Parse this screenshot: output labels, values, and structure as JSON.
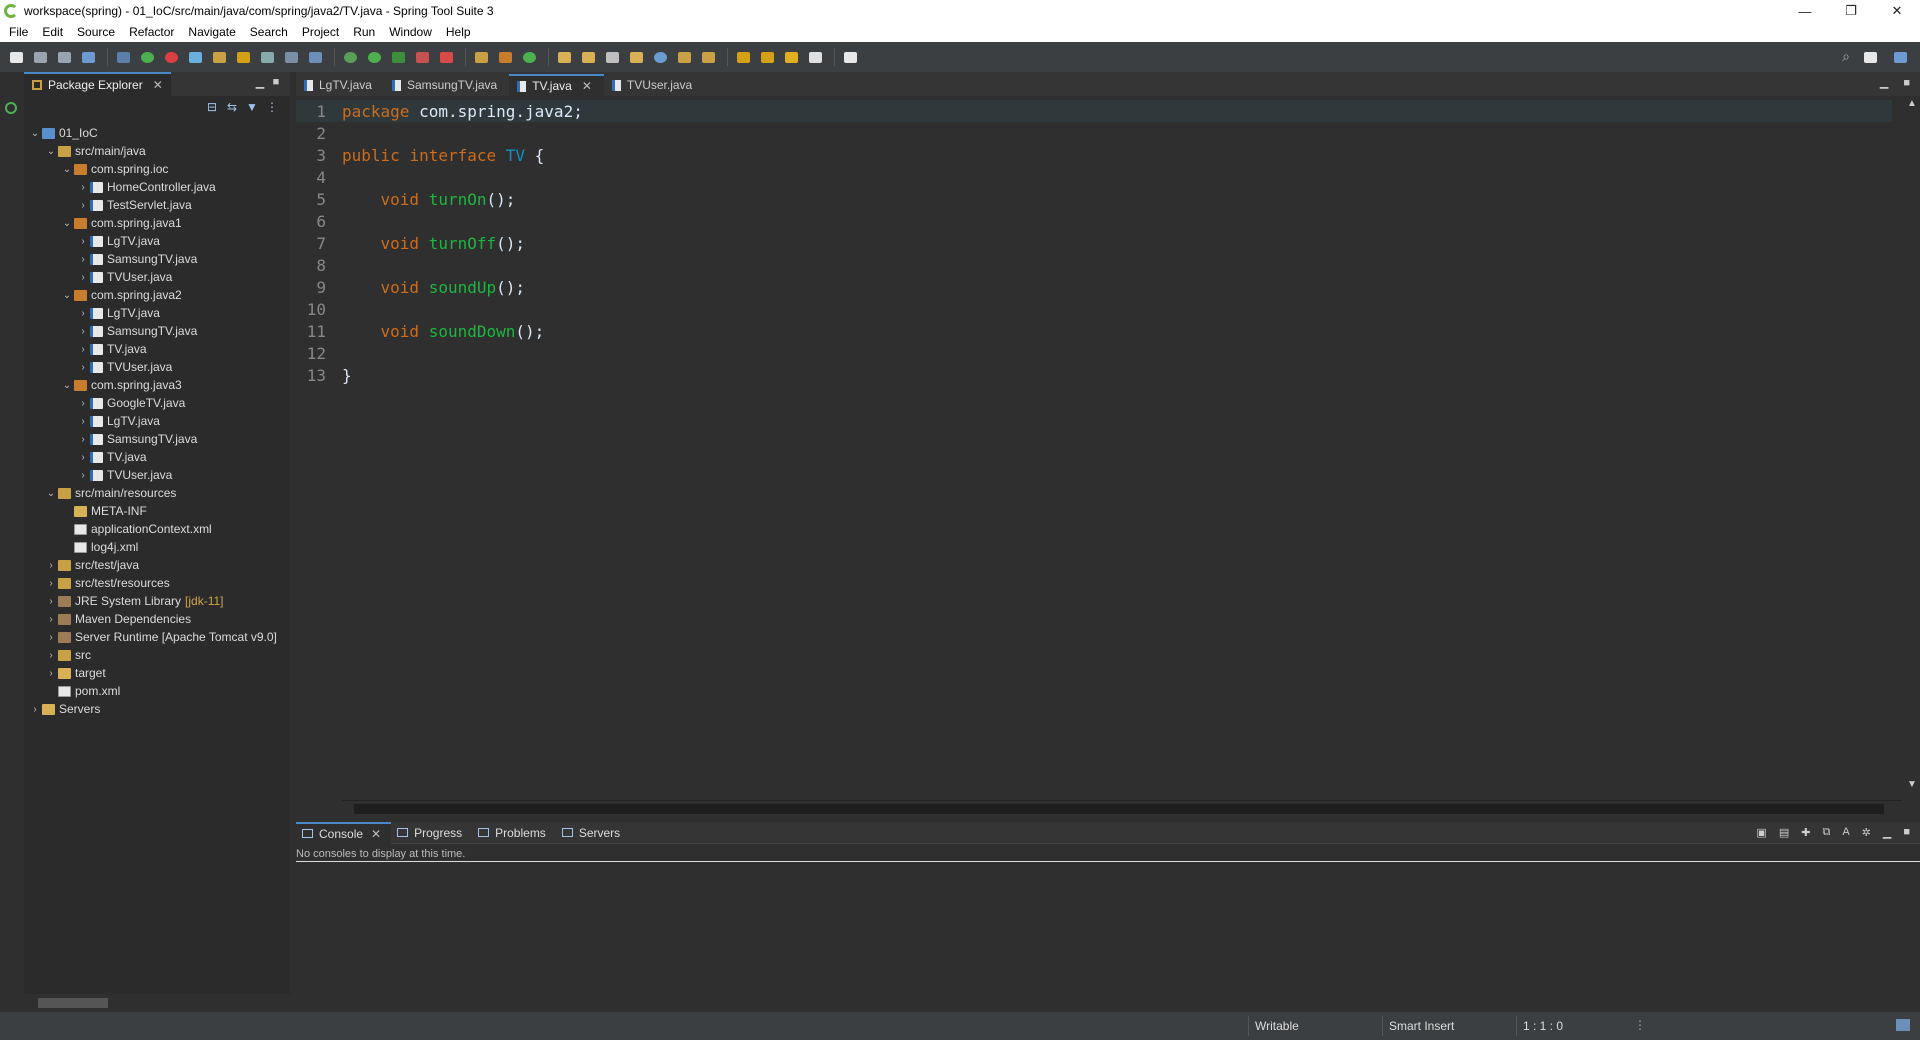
{
  "window": {
    "title": "workspace(spring) - 01_IoC/src/main/java/com/spring/java2/TV.java - Spring Tool Suite 3",
    "min_glyph": "—",
    "restore_glyph": "❐",
    "close_glyph": "✕"
  },
  "menu": [
    "File",
    "Edit",
    "Source",
    "Refactor",
    "Navigate",
    "Search",
    "Project",
    "Run",
    "Window",
    "Help"
  ],
  "explorer": {
    "tab_label": "Package Explorer",
    "close_glyph": "✕",
    "rows": [
      {
        "label": "01_IoC",
        "icon": "project-icon",
        "expanded": true,
        "level": 0
      },
      {
        "label": "src/main/java",
        "icon": "source-folder-icon",
        "expanded": true,
        "level": 1
      },
      {
        "label": "com.spring.ioc",
        "icon": "package-icon",
        "expanded": true,
        "level": 2
      },
      {
        "label": "HomeController.java",
        "icon": "java-file-icon",
        "expanded": false,
        "level": 3
      },
      {
        "label": "TestServlet.java",
        "icon": "java-file-icon",
        "expanded": false,
        "level": 3
      },
      {
        "label": "com.spring.java1",
        "icon": "package-icon",
        "expanded": true,
        "level": 2
      },
      {
        "label": "LgTV.java",
        "icon": "java-file-icon",
        "expanded": false,
        "level": 3
      },
      {
        "label": "SamsungTV.java",
        "icon": "java-file-icon",
        "expanded": false,
        "level": 3
      },
      {
        "label": "TVUser.java",
        "icon": "java-file-icon",
        "expanded": false,
        "level": 3
      },
      {
        "label": "com.spring.java2",
        "icon": "package-icon",
        "expanded": true,
        "level": 2
      },
      {
        "label": "LgTV.java",
        "icon": "java-file-icon",
        "expanded": false,
        "level": 3
      },
      {
        "label": "SamsungTV.java",
        "icon": "java-file-icon",
        "expanded": false,
        "level": 3
      },
      {
        "label": "TV.java",
        "icon": "java-file-icon",
        "expanded": false,
        "level": 3
      },
      {
        "label": "TVUser.java",
        "icon": "java-file-icon",
        "expanded": false,
        "level": 3
      },
      {
        "label": "com.spring.java3",
        "icon": "package-icon",
        "expanded": true,
        "level": 2
      },
      {
        "label": "GoogleTV.java",
        "icon": "java-file-icon",
        "expanded": false,
        "level": 3
      },
      {
        "label": "LgTV.java",
        "icon": "java-file-icon",
        "expanded": false,
        "level": 3
      },
      {
        "label": "SamsungTV.java",
        "icon": "java-file-icon",
        "expanded": false,
        "level": 3
      },
      {
        "label": "TV.java",
        "icon": "java-file-icon",
        "expanded": false,
        "level": 3
      },
      {
        "label": "TVUser.java",
        "icon": "java-file-icon",
        "expanded": false,
        "level": 3
      },
      {
        "label": "src/main/resources",
        "icon": "source-folder-icon",
        "expanded": true,
        "level": 1
      },
      {
        "label": "META-INF",
        "icon": "folder-icon",
        "expanded": null,
        "level": 2
      },
      {
        "label": "applicationContext.xml",
        "icon": "xml-file-icon",
        "expanded": null,
        "level": 2
      },
      {
        "label": "log4j.xml",
        "icon": "xml-file-icon",
        "expanded": null,
        "level": 2
      },
      {
        "label": "src/test/java",
        "icon": "source-folder-icon",
        "expanded": false,
        "level": 1
      },
      {
        "label": "src/test/resources",
        "icon": "source-folder-icon",
        "expanded": false,
        "level": 1
      },
      {
        "label": "JRE System Library",
        "annotation": "[jdk-11]",
        "icon": "library-icon",
        "expanded": false,
        "level": 1
      },
      {
        "label": "Maven Dependencies",
        "icon": "library-icon",
        "expanded": false,
        "level": 1
      },
      {
        "label": "Server Runtime [Apache Tomcat v9.0]",
        "icon": "library-icon",
        "expanded": false,
        "level": 1
      },
      {
        "label": "src",
        "icon": "source-folder-icon",
        "expanded": false,
        "level": 1
      },
      {
        "label": "target",
        "icon": "folder-icon",
        "expanded": false,
        "level": 1
      },
      {
        "label": "pom.xml",
        "icon": "xml-file-icon",
        "expanded": null,
        "level": 1
      },
      {
        "label": "Servers",
        "icon": "folder-icon",
        "expanded": false,
        "level": 0
      }
    ]
  },
  "editor": {
    "tabs": [
      {
        "label": "LgTV.java",
        "active": false
      },
      {
        "label": "SamsungTV.java",
        "active": false
      },
      {
        "label": "TV.java",
        "active": true
      },
      {
        "label": "TVUser.java",
        "active": false
      }
    ],
    "lines": [
      {
        "num": "1",
        "tokens": [
          [
            "kw",
            "package"
          ],
          [
            "plain",
            " com.spring.java2;"
          ]
        ]
      },
      {
        "num": "2",
        "tokens": []
      },
      {
        "num": "3",
        "tokens": [
          [
            "kw",
            "public"
          ],
          [
            "plain",
            " "
          ],
          [
            "kw",
            "interface"
          ],
          [
            "plain",
            " "
          ],
          [
            "type",
            "TV"
          ],
          [
            "plain",
            " {"
          ]
        ]
      },
      {
        "num": "4",
        "tokens": []
      },
      {
        "num": "5",
        "tokens": [
          [
            "plain",
            "    "
          ],
          [
            "kw",
            "void"
          ],
          [
            "plain",
            " "
          ],
          [
            "meth",
            "turnOn"
          ],
          [
            "plain",
            "();"
          ]
        ]
      },
      {
        "num": "6",
        "tokens": []
      },
      {
        "num": "7",
        "tokens": [
          [
            "plain",
            "    "
          ],
          [
            "kw",
            "void"
          ],
          [
            "plain",
            " "
          ],
          [
            "meth",
            "turnOff"
          ],
          [
            "plain",
            "();"
          ]
        ]
      },
      {
        "num": "8",
        "tokens": []
      },
      {
        "num": "9",
        "tokens": [
          [
            "plain",
            "    "
          ],
          [
            "kw",
            "void"
          ],
          [
            "plain",
            " "
          ],
          [
            "meth",
            "soundUp"
          ],
          [
            "plain",
            "();"
          ]
        ]
      },
      {
        "num": "10",
        "tokens": []
      },
      {
        "num": "11",
        "tokens": [
          [
            "plain",
            "    "
          ],
          [
            "kw",
            "void"
          ],
          [
            "plain",
            " "
          ],
          [
            "meth",
            "soundDown"
          ],
          [
            "plain",
            "();"
          ]
        ]
      },
      {
        "num": "12",
        "tokens": []
      },
      {
        "num": "13",
        "tokens": [
          [
            "plain",
            "}"
          ]
        ]
      }
    ]
  },
  "console": {
    "tabs": [
      {
        "label": "Console",
        "active": true
      },
      {
        "label": "Progress",
        "active": false
      },
      {
        "label": "Problems",
        "active": false
      },
      {
        "label": "Servers",
        "active": false
      }
    ],
    "message": "No consoles to display at this time."
  },
  "status": {
    "writable": "Writable",
    "insert_mode": "Smart Insert",
    "position": "1 : 1 : 0"
  },
  "colors": {
    "keyword": "#cc6c1d",
    "type": "#1290c3",
    "method": "#1eb540",
    "accent": "#4a88c7"
  }
}
